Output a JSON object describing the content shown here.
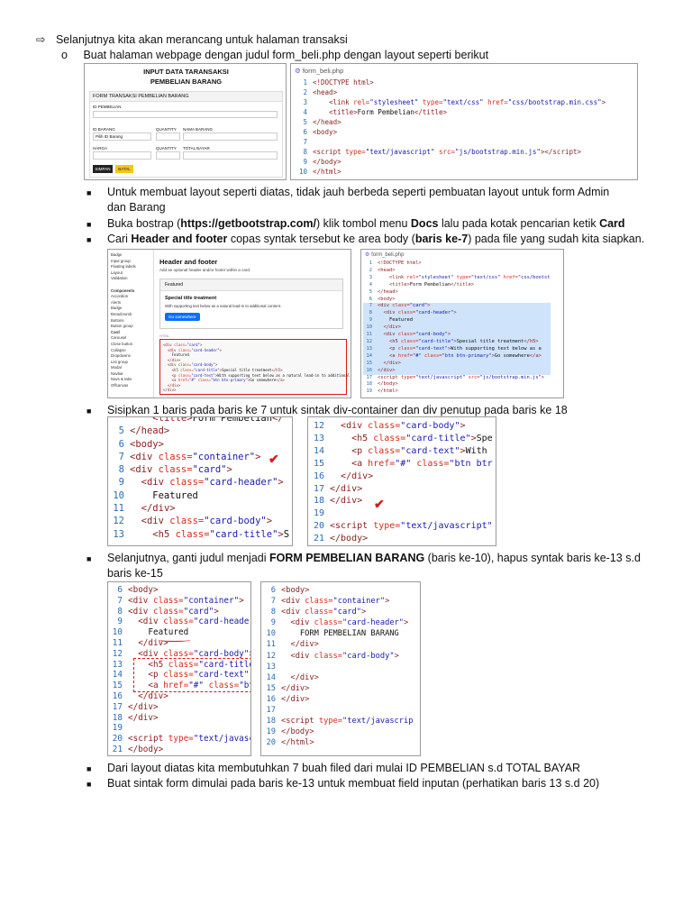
{
  "heading": {
    "arrow": "⇨",
    "text": "Selanjutnya kita akan merancang untuk halaman transaksi"
  },
  "sub": {
    "marker": "o",
    "text": "Buat halaman webpage dengan judul form_beli.php dengan layout seperti berikut"
  },
  "form_preview": {
    "title_line1": "INPUT DATA TARANSAKSI",
    "title_line2": "PEMBELIAN BARANG",
    "card_header": "FORM TRANSAKSI PEMBELIAN BARANG",
    "label_id": "ID PEMBELIAN",
    "label_id_barang": "ID BARANG",
    "label_quantity": "QUANTITY",
    "label_nama": "NAMA BARANG",
    "select_value": "Pilih ID Barang",
    "label_harga": "HARGA",
    "label_quantity2": "QUANTITY",
    "label_total": "TOTAL BAYAR",
    "btn_simpan": "SIMPAN",
    "btn_batal": "BATAL"
  },
  "code1": {
    "filename": "form_beli.php",
    "lines": [
      {
        "n": "1",
        "html": "<span class='tg'>&lt;!DOCTYPE html&gt;</span>"
      },
      {
        "n": "2",
        "html": "<span class='tg'>&lt;head&gt;</span>"
      },
      {
        "n": "3",
        "html": "    <span class='tg'>&lt;link</span> <span class='at'>rel=</span><span class='st'>\"stylesheet\"</span> <span class='at'>type=</span><span class='st'>\"text/css\"</span> <span class='at'>href=</span><span class='st'>\"css/bootstrap.min.css\"</span><span class='tg'>&gt;</span>"
      },
      {
        "n": "4",
        "html": "    <span class='tg'>&lt;title&gt;</span>Form Pembelian<span class='tg'>&lt;/title&gt;</span>"
      },
      {
        "n": "5",
        "html": "<span class='tg'>&lt;/head&gt;</span>"
      },
      {
        "n": "6",
        "html": "<span class='tg'>&lt;body&gt;</span>"
      },
      {
        "n": "7",
        "html": ""
      },
      {
        "n": "8",
        "html": "<span class='tg'>&lt;script</span> <span class='at'>type=</span><span class='st'>\"text/javascript\"</span> <span class='at'>src=</span><span class='st'>\"js/bootstrap.min.js\"</span><span class='tg'>&gt;&lt;/script&gt;</span>"
      },
      {
        "n": "9",
        "html": "<span class='tg'>&lt;/body&gt;</span>"
      },
      {
        "n": "10",
        "html": "<span class='tg'>&lt;/html&gt;</span>"
      }
    ]
  },
  "bullets1": [
    "Untuk membuat layout seperti diatas, tidak jauh berbeda seperti pembuatan layout untuk form Admin",
    "dan Barang"
  ],
  "bullet2": {
    "pre": "Buka bostrap (",
    "bold_url": "https://getbootstrap.com/",
    "mid": ") klik tombol menu  ",
    "bold_docs": "Docs",
    "post": " lalu pada kotak pencarian ketik ",
    "bold_card": "Card"
  },
  "bullet3": {
    "pre": "Cari ",
    "bold1": "Header and footer",
    "mid": " copas syntak tersebut ke area body (",
    "bold2": "baris ke-7",
    "post": ")  pada file yang sudah kita siapkan."
  },
  "bootstrap_docs": {
    "sidebar": [
      "Badge",
      "Input group",
      "Floating labels",
      "Layout",
      "Validation",
      "",
      "Components",
      "Accordion",
      "Alerts",
      "Badge",
      "Breadcrumb",
      "Buttons",
      "Button group",
      "Card",
      "Carousel",
      "Close button",
      "Collapse",
      "Dropdowns",
      "List group",
      "Modal",
      "Navbar",
      "Navs & tabs",
      "Offcanvas"
    ],
    "title": "Header and footer",
    "desc": "Add an optional header and/or footer within a card.",
    "featured": "Featured",
    "card_title": "Special title treatment",
    "card_text": "With supporting text below as a natural lead-in to additional content.",
    "btn": "Go somewhere"
  },
  "code2": {
    "filename": "form_beli.php",
    "lines": [
      {
        "n": "1",
        "html": "<span class='tg'>&lt;!DOCTYPE html&gt;</span>",
        "hl": false
      },
      {
        "n": "2",
        "html": "<span class='tg'>&lt;head&gt;</span>",
        "hl": false
      },
      {
        "n": "3",
        "html": "    <span class='tg'>&lt;link</span> <span class='at'>rel=</span><span class='st'>\"stylesheet\"</span> <span class='at'>type=</span><span class='st'>\"text/css\"</span> <span class='at'>href=</span><span class='st'>\"css/bootst</span>",
        "hl": false
      },
      {
        "n": "4",
        "html": "    <span class='tg'>&lt;title&gt;</span>Form Pembelian<span class='tg'>&lt;/title&gt;</span>",
        "hl": false
      },
      {
        "n": "5",
        "html": "<span class='tg'>&lt;/head&gt;</span>",
        "hl": false
      },
      {
        "n": "6",
        "html": "<span class='tg'>&lt;body&gt;</span>",
        "hl": false
      },
      {
        "n": "7",
        "html": "<span class='tg'>&lt;div</span> <span class='at'>class=</span><span class='st'>\"card\"</span><span class='tg'>&gt;</span>",
        "hl": true
      },
      {
        "n": "8",
        "html": "  <span class='tg'>&lt;div</span> <span class='at'>class=</span><span class='st'>\"card-header\"</span><span class='tg'>&gt;</span>",
        "hl": true
      },
      {
        "n": "9",
        "html": "    Featured",
        "hl": true
      },
      {
        "n": "10",
        "html": "  <span class='tg'>&lt;/div&gt;</span>",
        "hl": true
      },
      {
        "n": "11",
        "html": "  <span class='tg'>&lt;div</span> <span class='at'>class=</span><span class='st'>\"card-body\"</span><span class='tg'>&gt;</span>",
        "hl": true
      },
      {
        "n": "12",
        "html": "    <span class='tg'>&lt;h5</span> <span class='at'>class=</span><span class='st'>\"card-title\"</span><span class='tg'>&gt;</span>Special title treatment<span class='tg'>&lt;/h5&gt;</span>",
        "hl": true
      },
      {
        "n": "13",
        "html": "    <span class='tg'>&lt;p</span> <span class='at'>class=</span><span class='st'>\"card-text\"</span><span class='tg'>&gt;</span>With supporting text below as a",
        "hl": true
      },
      {
        "n": "14",
        "html": "    <span class='tg'>&lt;a</span> <span class='at'>href=</span><span class='st'>\"#\"</span> <span class='at'>class=</span><span class='st'>\"btn btn-primary\"</span><span class='tg'>&gt;</span>Go somewhere<span class='tg'>&lt;/a&gt;</span>",
        "hl": true
      },
      {
        "n": "15",
        "html": "  <span class='tg'>&lt;/div&gt;</span>",
        "hl": true
      },
      {
        "n": "16",
        "html": "<span class='tg'>&lt;/div&gt;</span>",
        "hl": true
      },
      {
        "n": "17",
        "html": "<span class='tg'>&lt;script</span> <span class='at'>type=</span><span class='st'>\"text/javascript\"</span> <span class='at'>src=</span><span class='st'>\"js/bootstrap.min.js\"</span><span class='tg'>&gt;</span>",
        "hl": false
      },
      {
        "n": "18",
        "html": "<span class='tg'>&lt;/body&gt;</span>",
        "hl": false
      },
      {
        "n": "19",
        "html": "<span class='tg'>&lt;/html&gt;</span>",
        "hl": false
      }
    ]
  },
  "bullet4": "Sisipkan 1 baris pada baris ke 7 untuk sintak div-container dan div penutup pada baris ke 18",
  "code3a": {
    "lines": [
      {
        "n": "",
        "html": "    <span class='tg'>&lt;title&gt;</span>Form Pembelian<span class='tg'>&lt;/</span>"
      },
      {
        "n": "5",
        "html": "<span class='tg'>&lt;/head&gt;</span>"
      },
      {
        "n": "6",
        "html": "<span class='tg'>&lt;body&gt;</span>"
      },
      {
        "n": "7",
        "html": "<span class='tg'>&lt;div</span> <span class='at'>class=</span><span class='st'>\"container\"</span><span class='tg'>&gt;</span>"
      },
      {
        "n": "8",
        "html": "<span class='tg'>&lt;div</span> <span class='at'>class=</span><span class='st'>\"card\"</span><span class='tg'>&gt;</span>"
      },
      {
        "n": "9",
        "html": "  <span class='tg'>&lt;div</span> <span class='at'>class=</span><span class='st'>\"card-header\"</span><span class='tg'>&gt;</span>"
      },
      {
        "n": "10",
        "html": "    Featured"
      },
      {
        "n": "11",
        "html": "  <span class='tg'>&lt;/div&gt;</span>"
      },
      {
        "n": "12",
        "html": "  <span class='tg'>&lt;div</span> <span class='at'>class=</span><span class='st'>\"card-body\"</span><span class='tg'>&gt;</span>"
      },
      {
        "n": "13",
        "html": "    <span class='tg'>&lt;h5</span> <span class='at'>class=</span><span class='st'>\"card-title\"</span><span class='tg'>&gt;</span>S"
      }
    ]
  },
  "code3b": {
    "lines": [
      {
        "n": "12",
        "html": "  <span class='tg'>&lt;div</span> <span class='at'>class=</span><span class='st'>\"card-body\"</span><span class='tg'>&gt;</span>"
      },
      {
        "n": "13",
        "html": "    <span class='tg'>&lt;h5</span> <span class='at'>class=</span><span class='st'>\"card-title\"</span><span class='tg'>&gt;</span>Spe"
      },
      {
        "n": "14",
        "html": "    <span class='tg'>&lt;p</span> <span class='at'>class=</span><span class='st'>\"card-text\"</span><span class='tg'>&gt;</span>With"
      },
      {
        "n": "15",
        "html": "    <span class='tg'>&lt;a</span> <span class='at'>href=</span><span class='st'>\"#\"</span> <span class='at'>class=</span><span class='st'>\"btn btr</span>"
      },
      {
        "n": "16",
        "html": "  <span class='tg'>&lt;/div&gt;</span>"
      },
      {
        "n": "17",
        "html": "<span class='tg'>&lt;/div&gt;</span>"
      },
      {
        "n": "18",
        "html": "<span class='tg'>&lt;/div&gt;</span>"
      },
      {
        "n": "19",
        "html": ""
      },
      {
        "n": "20",
        "html": "<span class='tg'>&lt;script</span> <span class='at'>type=</span><span class='st'>\"text/javascript\"</span>"
      },
      {
        "n": "21",
        "html": "<span class='tg'>&lt;/body&gt;</span>"
      }
    ]
  },
  "bullet5": {
    "pre": "Selanjutnya, ganti judul menjadi ",
    "bold": "FORM PEMBELIAN BARANG",
    "post": " (baris ke-10), hapus syntak baris ke-13 s.d",
    "line2": "baris ke-15"
  },
  "code4a": {
    "lines": [
      {
        "n": "6",
        "html": "<span class='tg'>&lt;body&gt;</span>"
      },
      {
        "n": "7",
        "html": "<span class='tg'>&lt;div</span> <span class='at'>class=</span><span class='st'>\"container\"</span><span class='tg'>&gt;</span>"
      },
      {
        "n": "8",
        "html": "<span class='tg'>&lt;div</span> <span class='at'>class=</span><span class='st'>\"card\"</span><span class='tg'>&gt;</span>"
      },
      {
        "n": "9",
        "html": "  <span class='tg'>&lt;div</span> <span class='at'>class=</span><span class='st'>\"card-header</span>"
      },
      {
        "n": "10",
        "html": "    Featured"
      },
      {
        "n": "11",
        "html": "  <span class='tg'>&lt;/div&gt;</span>"
      },
      {
        "n": "12",
        "html": "  <span class='tg'>&lt;div</span> <span class='at'>class=</span><span class='st'>\"card-body\"</span><span class='tg'>&gt;</span>"
      },
      {
        "n": "13",
        "html": "    <span class='tg'>&lt;h5</span> <span class='at'>class=</span><span class='st'>\"card-title</span>"
      },
      {
        "n": "14",
        "html": "    <span class='tg'>&lt;p</span> <span class='at'>class=</span><span class='st'>\"card-text\"</span>"
      },
      {
        "n": "15",
        "html": "    <span class='tg'>&lt;a</span> <span class='at'>href=</span><span class='st'>\"#\"</span> <span class='at'>class=</span><span class='st'>\"bt</span>"
      },
      {
        "n": "16",
        "html": "  <span class='tg'>&lt;/div&gt;</span>"
      },
      {
        "n": "17",
        "html": "<span class='tg'>&lt;/div&gt;</span>"
      },
      {
        "n": "18",
        "html": "<span class='tg'>&lt;/div&gt;</span>"
      },
      {
        "n": "19",
        "html": ""
      },
      {
        "n": "20",
        "html": "<span class='tg'>&lt;script</span> <span class='at'>type=</span><span class='st'>\"text/javasc</span>"
      },
      {
        "n": "21",
        "html": "<span class='tg'>&lt;/body&gt;</span>"
      }
    ]
  },
  "code4b": {
    "lines": [
      {
        "n": "6",
        "html": "<span class='tg'>&lt;body&gt;</span>"
      },
      {
        "n": "7",
        "html": "<span class='tg'>&lt;div</span> <span class='at'>class=</span><span class='st'>\"container\"</span><span class='tg'>&gt;</span>"
      },
      {
        "n": "8",
        "html": "<span class='tg'>&lt;div</span> <span class='at'>class=</span><span class='st'>\"card\"</span><span class='tg'>&gt;</span>"
      },
      {
        "n": "9",
        "html": "  <span class='tg'>&lt;div</span> <span class='at'>class=</span><span class='st'>\"card-header\"</span><span class='tg'>&gt;</span>"
      },
      {
        "n": "10",
        "html": "    FORM PEMBELIAN BARANG"
      },
      {
        "n": "11",
        "html": "  <span class='tg'>&lt;/div&gt;</span>"
      },
      {
        "n": "12",
        "html": "  <span class='tg'>&lt;div</span> <span class='at'>class=</span><span class='st'>\"card-body\"</span><span class='tg'>&gt;</span>"
      },
      {
        "n": "13",
        "html": ""
      },
      {
        "n": "14",
        "html": "  <span class='tg'>&lt;/div&gt;</span>"
      },
      {
        "n": "15",
        "html": "<span class='tg'>&lt;/div&gt;</span>"
      },
      {
        "n": "16",
        "html": "<span class='tg'>&lt;/div&gt;</span>"
      },
      {
        "n": "17",
        "html": ""
      },
      {
        "n": "18",
        "html": "<span class='tg'>&lt;script</span> <span class='at'>type=</span><span class='st'>\"text/javascrip</span>"
      },
      {
        "n": "19",
        "html": "<span class='tg'>&lt;/body&gt;</span>"
      },
      {
        "n": "20",
        "html": "<span class='tg'>&lt;/html&gt;</span>"
      }
    ]
  },
  "bullet6": "Dari layout diatas kita membutuhkan 7 buah filed dari mulai ID PEMBELIAN s.d TOTAL BAYAR",
  "bullet7": "Buat sintak form dimulai pada baris ke-13 untuk membuat field inputan (perhatikan baris 13 s.d 20)",
  "colors": {
    "tag": "#8a1d1d",
    "attr": "#d52b1e",
    "string": "#1a1ab0",
    "line_number": "#2b6cb0",
    "highlight": "#cfe3fb",
    "annotation_red": "#e01515",
    "primary_btn": "#0d6efd",
    "yellow_btn": "#f5c518"
  }
}
